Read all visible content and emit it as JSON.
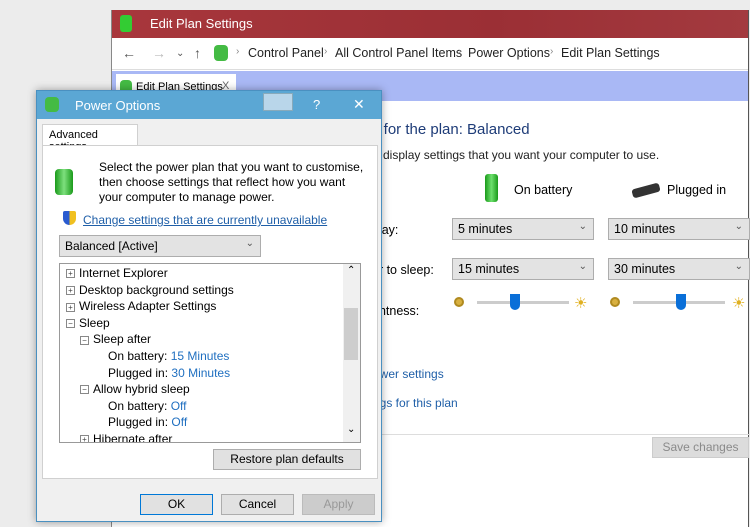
{
  "window": {
    "title": "Edit Plan Settings",
    "breadcrumbs": [
      "Control Panel",
      "All Control Panel Items",
      "Power Options",
      "Edit Plan Settings"
    ],
    "tab": {
      "label": "Edit Plan Settings",
      "close": "X"
    },
    "heading": "s for the plan: Balanced",
    "subheading": "d display settings that you want your computer to use.",
    "columns": {
      "battery": "On battery",
      "plugged": "Plugged in"
    },
    "rows": [
      {
        "label": "play:",
        "battery": "5 minutes",
        "plugged": "10 minutes"
      },
      {
        "label": "er to sleep:",
        "battery": "15 minutes",
        "plugged": "30 minutes"
      }
    ],
    "brightness": {
      "label": "ghtness:",
      "battery_percent": 50,
      "plugged_percent": 50
    },
    "links": [
      "ower settings",
      "ngs for this plan"
    ],
    "save_button": "Save changes",
    "colors": {
      "titlebar": "#a33a3f",
      "tabbar": "#a9b8f5",
      "link": "#1f5fa8"
    }
  },
  "dialog": {
    "title": "Power Options",
    "help": "?",
    "close": "✕",
    "tab": "Advanced settings",
    "description": "Select the power plan that you want to customise, then choose settings that reflect how you want your computer to manage power.",
    "change_link": "Change settings that are currently unavailable",
    "plan": "Balanced [Active]",
    "tree": [
      {
        "label": "Internet Explorer",
        "state": "+",
        "level": 0
      },
      {
        "label": "Desktop background settings",
        "state": "+",
        "level": 0
      },
      {
        "label": "Wireless Adapter Settings",
        "state": "+",
        "level": 0
      },
      {
        "label": "Sleep",
        "state": "-",
        "level": 0
      },
      {
        "label": "Sleep after",
        "state": "-",
        "level": 1
      },
      {
        "label": "On battery:",
        "value": "15 Minutes",
        "level": 2
      },
      {
        "label": "Plugged in:",
        "value": "30 Minutes",
        "level": 2
      },
      {
        "label": "Allow hybrid sleep",
        "state": "-",
        "level": 1
      },
      {
        "label": "On battery:",
        "value": "Off",
        "level": 2
      },
      {
        "label": "Plugged in:",
        "value": "Off",
        "level": 2
      },
      {
        "label": "Hibernate after",
        "state": "+",
        "level": 1
      }
    ],
    "restore": "Restore plan defaults",
    "ok": "OK",
    "cancel": "Cancel",
    "apply": "Apply",
    "colors": {
      "titlebar": "#5ba7d4"
    }
  }
}
